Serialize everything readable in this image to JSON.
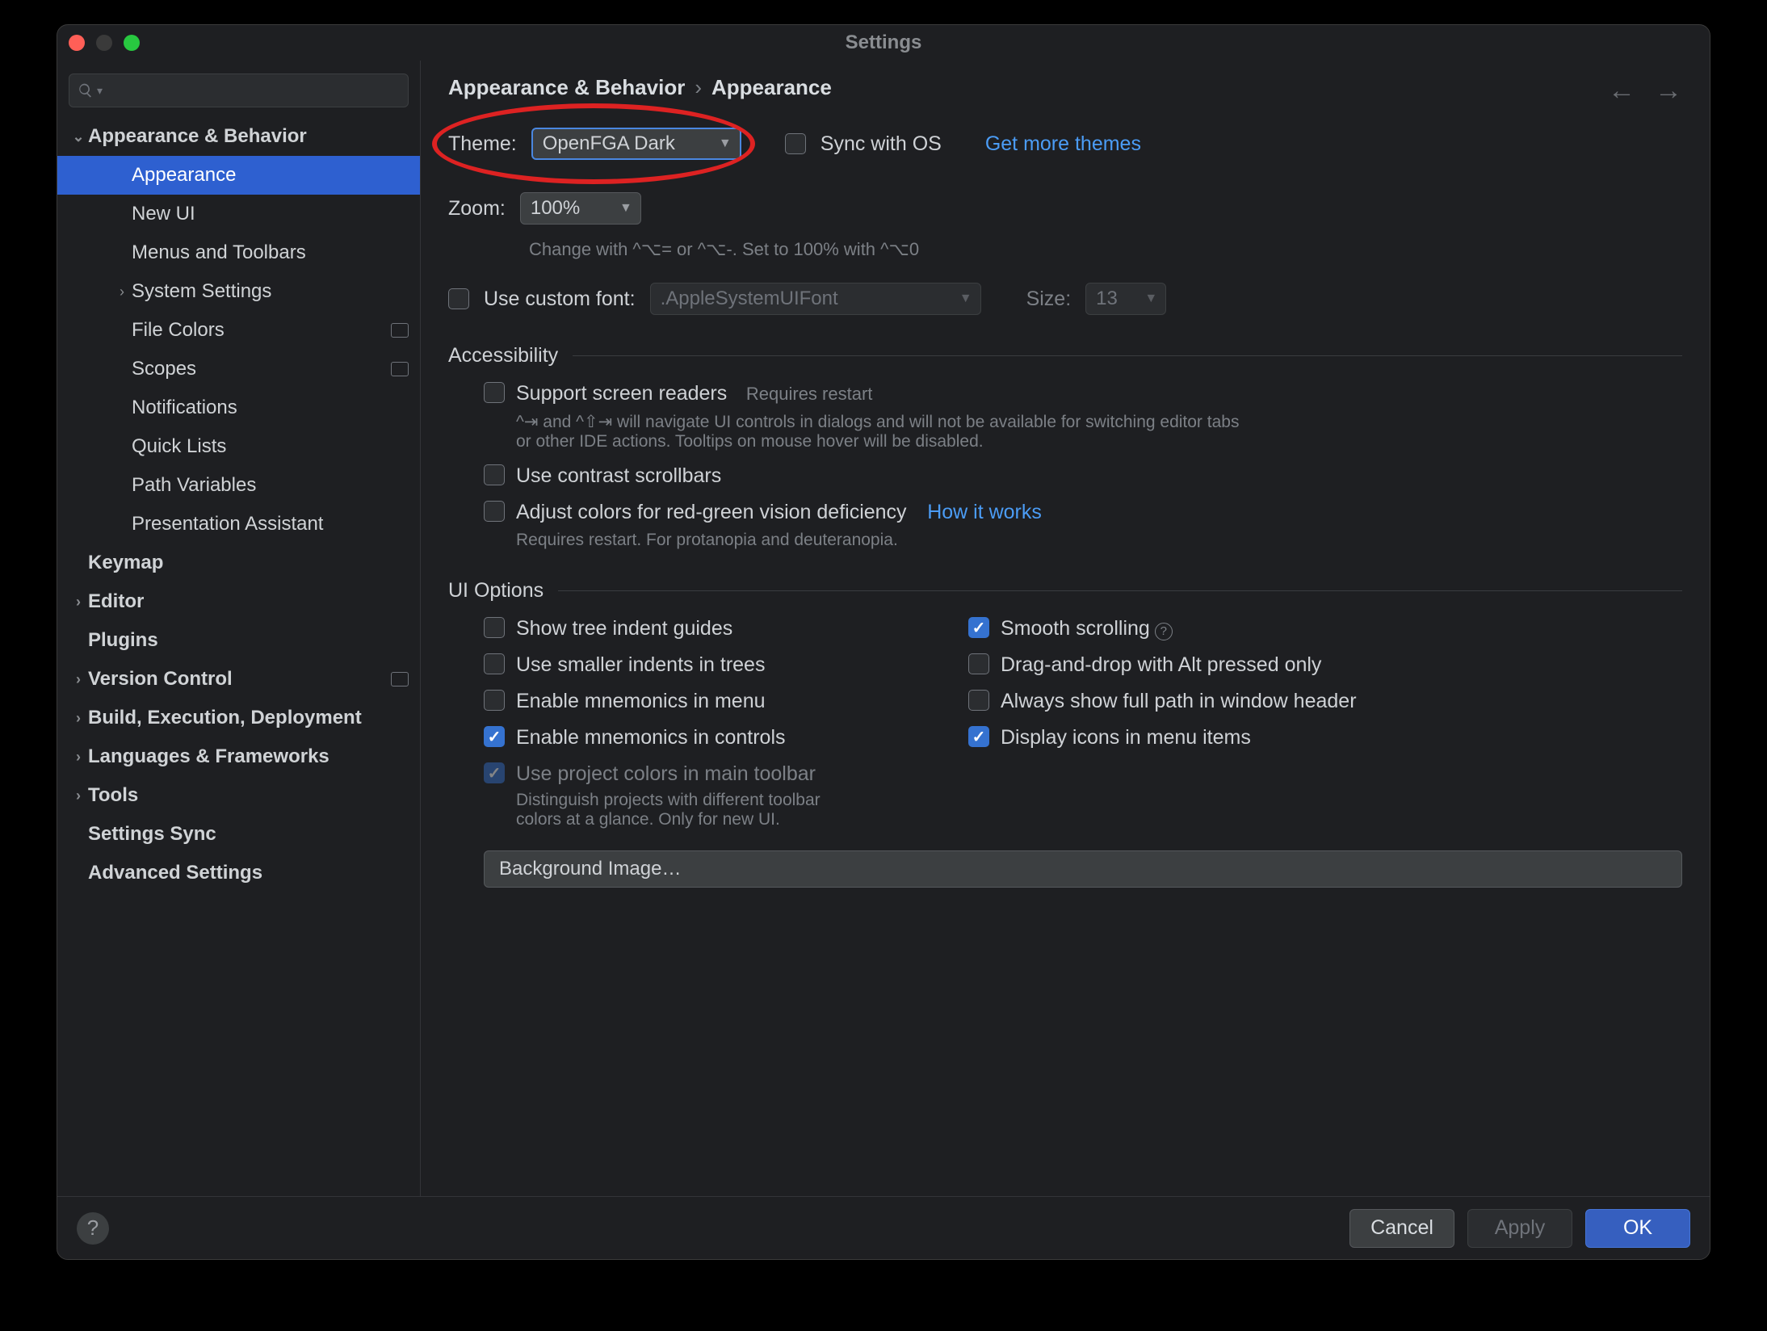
{
  "window_title": "Settings",
  "search_placeholder": "",
  "sidebar": {
    "items": [
      {
        "label": "Appearance & Behavior",
        "depth": 0,
        "bold": true,
        "arrow": "down",
        "selected": false
      },
      {
        "label": "Appearance",
        "depth": 1,
        "bold": false,
        "selected": true
      },
      {
        "label": "New UI",
        "depth": 1,
        "bold": false
      },
      {
        "label": "Menus and Toolbars",
        "depth": 1,
        "bold": false
      },
      {
        "label": "System Settings",
        "depth": 1,
        "bold": false,
        "arrow": "right"
      },
      {
        "label": "File Colors",
        "depth": 1,
        "bold": false,
        "tag": true
      },
      {
        "label": "Scopes",
        "depth": 1,
        "bold": false,
        "tag": true
      },
      {
        "label": "Notifications",
        "depth": 1,
        "bold": false
      },
      {
        "label": "Quick Lists",
        "depth": 1,
        "bold": false
      },
      {
        "label": "Path Variables",
        "depth": 1,
        "bold": false
      },
      {
        "label": "Presentation Assistant",
        "depth": 1,
        "bold": false
      },
      {
        "label": "Keymap",
        "depth": 0,
        "bold": true
      },
      {
        "label": "Editor",
        "depth": 0,
        "bold": true,
        "arrow": "right"
      },
      {
        "label": "Plugins",
        "depth": 0,
        "bold": true
      },
      {
        "label": "Version Control",
        "depth": 0,
        "bold": true,
        "arrow": "right",
        "tag": true
      },
      {
        "label": "Build, Execution, Deployment",
        "depth": 0,
        "bold": true,
        "arrow": "right"
      },
      {
        "label": "Languages & Frameworks",
        "depth": 0,
        "bold": true,
        "arrow": "right"
      },
      {
        "label": "Tools",
        "depth": 0,
        "bold": true,
        "arrow": "right"
      },
      {
        "label": "Settings Sync",
        "depth": 0,
        "bold": true
      },
      {
        "label": "Advanced Settings",
        "depth": 0,
        "bold": true
      }
    ]
  },
  "breadcrumb": {
    "a": "Appearance & Behavior",
    "b": "Appearance"
  },
  "theme": {
    "label": "Theme:",
    "value": "OpenFGA Dark",
    "sync_label": "Sync with OS",
    "sync_checked": false,
    "more_link": "Get more themes"
  },
  "zoom": {
    "label": "Zoom:",
    "value": "100%",
    "hint": "Change with ^⌥= or ^⌥-. Set to 100% with ^⌥0"
  },
  "custom_font": {
    "checkbox_label": "Use custom font:",
    "checked": false,
    "font_value": ".AppleSystemUIFont",
    "size_label": "Size:",
    "size_value": "13"
  },
  "sections": {
    "accessibility": {
      "title": "Accessibility",
      "screen_readers": {
        "label": "Support screen readers",
        "hint_inline": "Requires restart",
        "hint_below": "^⇥ and ^⇧⇥ will navigate UI controls in dialogs and will not be available for switching editor tabs or other IDE actions. Tooltips on mouse hover will be disabled.",
        "checked": false
      },
      "contrast_scroll": {
        "label": "Use contrast scrollbars",
        "checked": false
      },
      "color_def": {
        "label": "Adjust colors for red-green vision deficiency",
        "link": "How it works",
        "hint_below": "Requires restart. For protanopia and deuteranopia.",
        "checked": false
      }
    },
    "ui_options": {
      "title": "UI Options",
      "left": [
        {
          "label": "Show tree indent guides",
          "checked": false
        },
        {
          "label": "Use smaller indents in trees",
          "checked": false
        },
        {
          "label": "Enable mnemonics in menu",
          "checked": false
        },
        {
          "label": "Enable mnemonics in controls",
          "checked": true
        },
        {
          "label": "Use project colors in main toolbar",
          "checked": true,
          "disabled": true,
          "hint": "Distinguish projects with different toolbar colors at a glance. Only for new UI."
        }
      ],
      "right": [
        {
          "label": "Smooth scrolling",
          "checked": true,
          "info": true
        },
        {
          "label": "Drag-and-drop with Alt pressed only",
          "checked": false
        },
        {
          "label": "Always show full path in window header",
          "checked": false
        },
        {
          "label": "Display icons in menu items",
          "checked": true
        }
      ],
      "bg_button": "Background Image…"
    }
  },
  "footer": {
    "cancel": "Cancel",
    "apply": "Apply",
    "ok": "OK"
  }
}
